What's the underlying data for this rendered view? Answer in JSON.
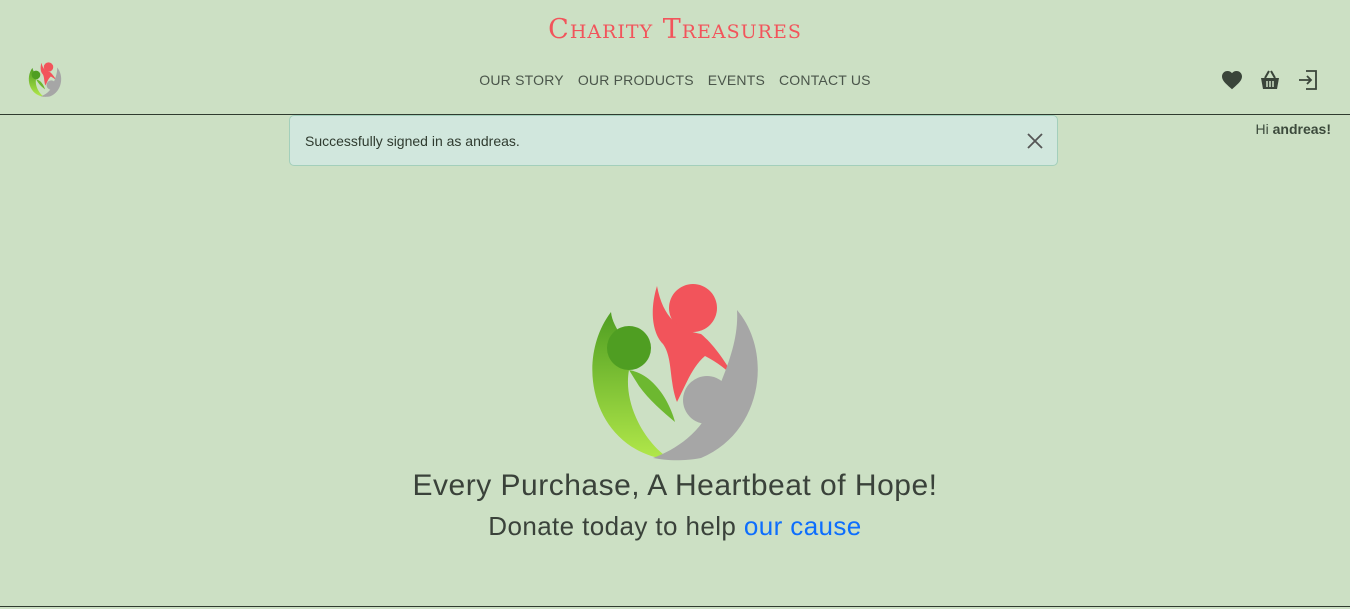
{
  "brand": {
    "title": "Charity Treasures"
  },
  "nav": {
    "items": [
      {
        "label": "OUR STORY"
      },
      {
        "label": "OUR PRODUCTS"
      },
      {
        "label": "EVENTS"
      },
      {
        "label": "CONTACT US"
      }
    ]
  },
  "header_icons": [
    "heart-icon",
    "basket-icon",
    "sign-in-icon"
  ],
  "alert": {
    "message": "Successfully signed in as andreas."
  },
  "greeting": {
    "prefix": "Hi",
    "username": "andreas!"
  },
  "hero": {
    "title": "Every Purchase, A Heartbeat of Hope!",
    "subtitle_text": "Donate today to help",
    "subtitle_link": "our cause"
  },
  "colors": {
    "background": "#cce0c4",
    "brand": "#f2545b",
    "alert_bg": "#d1e7dd",
    "link": "#0d6efd",
    "logo_green": "#5aa82a",
    "logo_red": "#f2545b",
    "logo_gray": "#a6a6a6"
  }
}
